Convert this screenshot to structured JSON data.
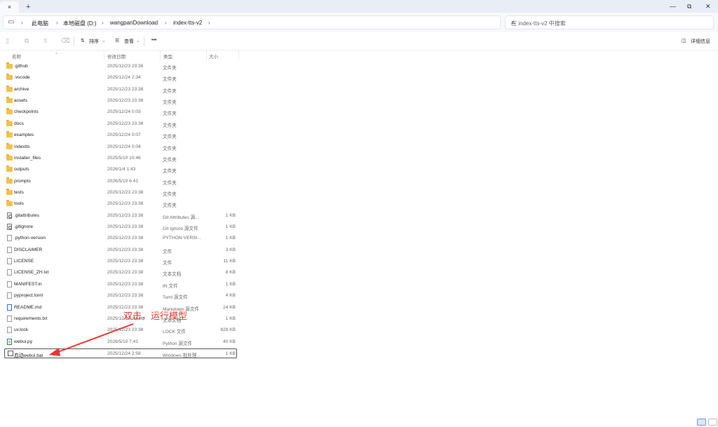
{
  "tab": {
    "close": "×",
    "new": "+"
  },
  "window": {
    "minimize": "—",
    "maximize": "⧉",
    "close": "✕"
  },
  "address": {
    "crumbs": [
      "此电脑",
      "本地磁盘 (D:)",
      "wangpanDownload",
      "index-tts-v2"
    ],
    "separator": "›"
  },
  "search": {
    "placeholder": "在 index-tts-v2 中搜索"
  },
  "toolbar": {
    "sort": "排序",
    "view": "查看",
    "more": "•••",
    "details": "详细信息"
  },
  "columns": {
    "name": "名称",
    "modified": "修改日期",
    "type": "类型",
    "size": "大小"
  },
  "files": [
    {
      "name": ".github",
      "date": "2025/12/23 23:36",
      "type": "文件夹",
      "size": "",
      "icon": "folder"
    },
    {
      "name": ".vscode",
      "date": "2025/12/24 2:34",
      "type": "文件夹",
      "size": "",
      "icon": "folder"
    },
    {
      "name": "archive",
      "date": "2025/12/23 23:38",
      "type": "文件夹",
      "size": "",
      "icon": "folder"
    },
    {
      "name": "assets",
      "date": "2025/12/23 23:38",
      "type": "文件夹",
      "size": "",
      "icon": "folder"
    },
    {
      "name": "checkpoints",
      "date": "2025/12/24 0:03",
      "type": "文件夹",
      "size": "",
      "icon": "folder"
    },
    {
      "name": "docs",
      "date": "2025/12/23 23:38",
      "type": "文件夹",
      "size": "",
      "icon": "folder"
    },
    {
      "name": "examples",
      "date": "2025/12/24 0:07",
      "type": "文件夹",
      "size": "",
      "icon": "folder"
    },
    {
      "name": "indextts",
      "date": "2025/12/24 0:04",
      "type": "文件夹",
      "size": "",
      "icon": "folder"
    },
    {
      "name": "installer_files",
      "date": "2025/5/10 10:46",
      "type": "文件夹",
      "size": "",
      "icon": "folder"
    },
    {
      "name": "outputs",
      "date": "2026/1/4 1:43",
      "type": "文件夹",
      "size": "",
      "icon": "folder"
    },
    {
      "name": "prompts",
      "date": "2026/5/10 6:41",
      "type": "文件夹",
      "size": "",
      "icon": "folder"
    },
    {
      "name": "tests",
      "date": "2025/12/23 23:38",
      "type": "文件夹",
      "size": "",
      "icon": "folder"
    },
    {
      "name": "tools",
      "date": "2025/12/23 23:38",
      "type": "文件夹",
      "size": "",
      "icon": "folder"
    },
    {
      "name": ".gitattributes",
      "date": "2025/12/23 23:38",
      "type": "Git Attributes 源...",
      "size": "1 KB",
      "icon": "gear"
    },
    {
      "name": ".gitignore",
      "date": "2025/12/23 23:38",
      "type": "Git Ignore 源文件",
      "size": "1 KB",
      "icon": "gear"
    },
    {
      "name": ".python-version",
      "date": "2025/12/23 23:38",
      "type": "PYTHON-VERSI...",
      "size": "1 KB",
      "icon": "file"
    },
    {
      "name": "DISCLAIMER",
      "date": "2025/12/23 23:38",
      "type": "文件",
      "size": "3 KB",
      "icon": "file"
    },
    {
      "name": "LICENSE",
      "date": "2025/12/23 23:38",
      "type": "文件",
      "size": "11 KB",
      "icon": "file"
    },
    {
      "name": "LICENSE_ZH.txt",
      "date": "2025/12/23 23:38",
      "type": "文本文档",
      "size": "8 KB",
      "icon": "file"
    },
    {
      "name": "MANIFEST.in",
      "date": "2025/12/23 23:38",
      "type": "IN 文件",
      "size": "1 KB",
      "icon": "file"
    },
    {
      "name": "pyproject.toml",
      "date": "2025/12/23 23:38",
      "type": "Toml 源文件",
      "size": "4 KB",
      "icon": "file"
    },
    {
      "name": "README.md",
      "date": "2025/12/23 23:38",
      "type": "Markdown 源文件",
      "size": "24 KB",
      "icon": "md"
    },
    {
      "name": "requirements.txt",
      "date": "2025/12/23 23:46",
      "type": "文本文档",
      "size": "1 KB",
      "icon": "file"
    },
    {
      "name": "uv.lock",
      "date": "2025/12/23 23:38",
      "type": "LOCK 文件",
      "size": "628 KB",
      "icon": "file"
    },
    {
      "name": "webui.py",
      "date": "2026/5/10 7:41",
      "type": "Python 源文件",
      "size": "40 KB",
      "icon": "py"
    },
    {
      "name": "启动webui.bat",
      "date": "2025/12/24 2:58",
      "type": "Windows 批处理...",
      "size": "1 KB",
      "icon": "bat"
    }
  ],
  "annotation": {
    "text": "双击，运行模型",
    "color": "#e03a30"
  }
}
